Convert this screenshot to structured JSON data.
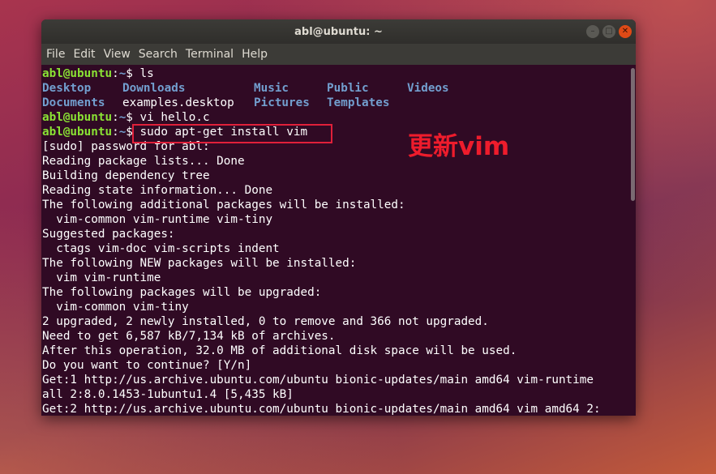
{
  "window": {
    "title": "abl@ubuntu: ~",
    "controls": {
      "minimize": "–",
      "maximize": "□",
      "close": "✕"
    }
  },
  "menu": [
    "File",
    "Edit",
    "View",
    "Search",
    "Terminal",
    "Help"
  ],
  "prompt": {
    "user": "abl@ubuntu",
    "path": ":~",
    "symbol": "$"
  },
  "terminal": {
    "cmd_ls": " ls",
    "ls_row1": [
      "Desktop",
      "Downloads",
      "Music",
      "Public",
      "Videos"
    ],
    "ls_row2_dir1": "Documents",
    "ls_row2_file": "examples.desktop",
    "ls_row2_dirs": [
      "Pictures",
      "Templates"
    ],
    "cmd_vi": " vi hello.c",
    "cmd_apt": " sudo apt-get install vim",
    "output": [
      "[sudo] password for abl:",
      "Reading package lists... Done",
      "Building dependency tree",
      "Reading state information... Done",
      "The following additional packages will be installed:",
      "  vim-common vim-runtime vim-tiny",
      "Suggested packages:",
      "  ctags vim-doc vim-scripts indent",
      "The following NEW packages will be installed:",
      "  vim vim-runtime",
      "The following packages will be upgraded:",
      "  vim-common vim-tiny",
      "2 upgraded, 2 newly installed, 0 to remove and 366 not upgraded.",
      "Need to get 6,587 kB/7,134 kB of archives.",
      "After this operation, 32.0 MB of additional disk space will be used.",
      "Do you want to continue? [Y/n]",
      "Get:1 http://us.archive.ubuntu.com/ubuntu bionic-updates/main amd64 vim-runtime",
      "all 2:8.0.1453-1ubuntu1.4 [5,435 kB]",
      "Get:2 http://us.archive.ubuntu.com/ubuntu bionic-updates/main amd64 vim amd64 2:"
    ]
  },
  "annotation": {
    "text": "更新vim",
    "color": "#ee1c2c"
  },
  "colors": {
    "terminal_bg": "#300a24",
    "prompt_user": "#8ae234",
    "directory": "#729fcf",
    "titlebar": "#3c3b37"
  }
}
